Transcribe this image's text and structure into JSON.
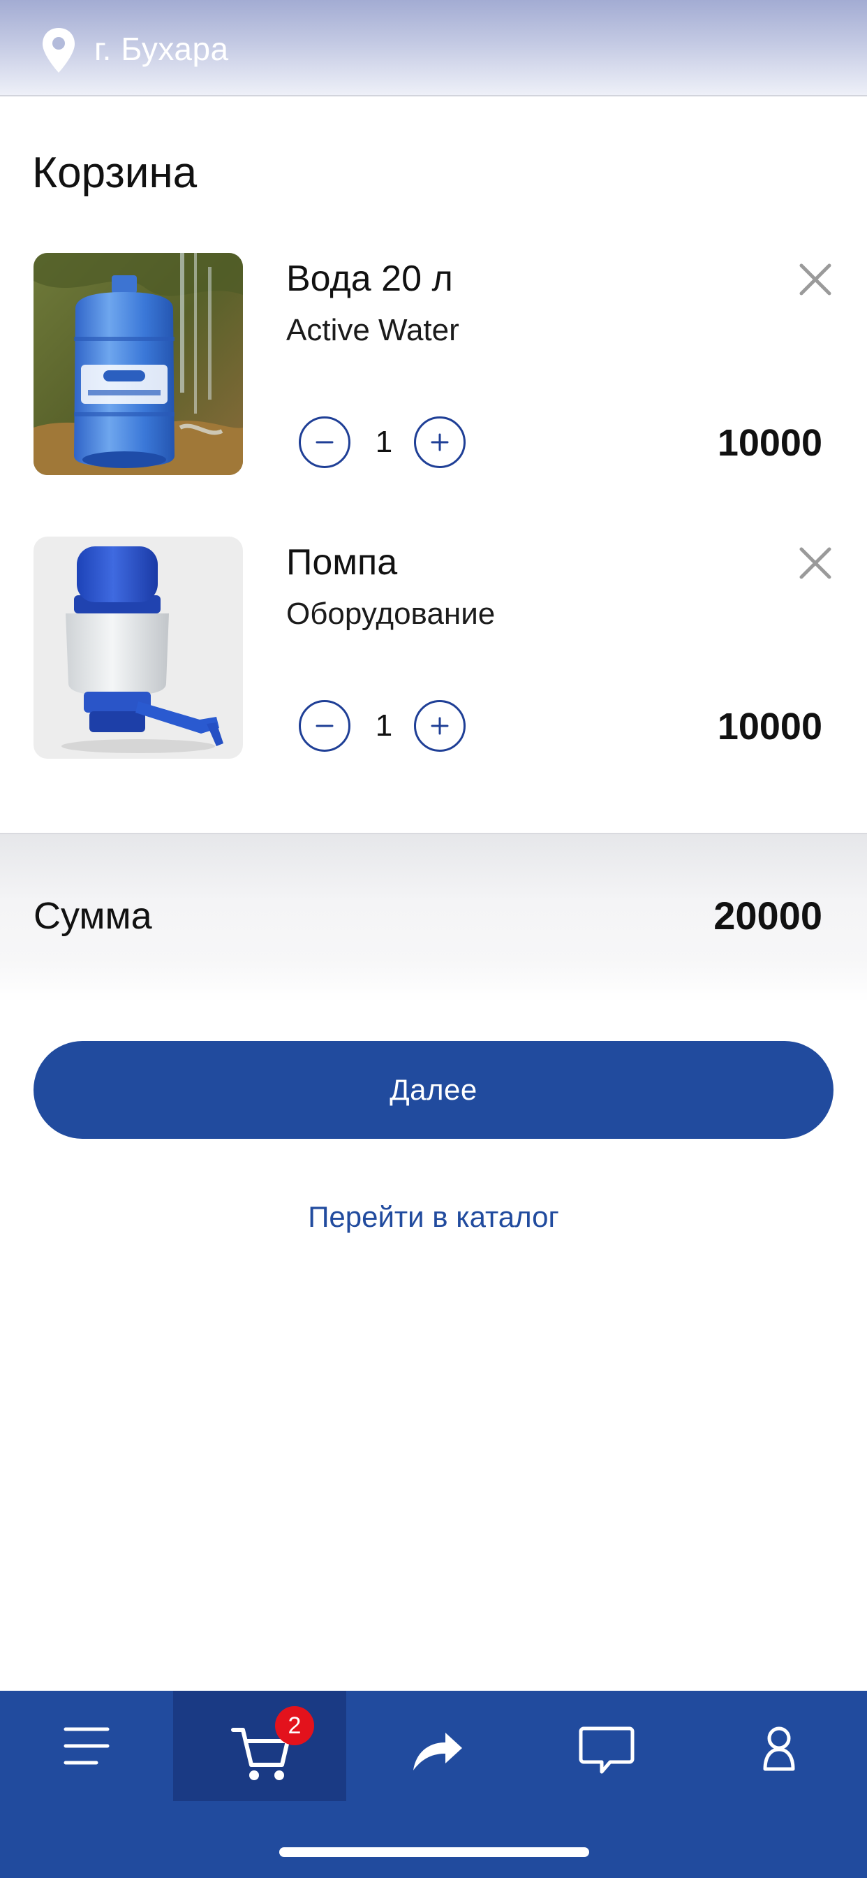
{
  "header": {
    "city": "г. Бухара"
  },
  "page": {
    "title": "Корзина"
  },
  "cart": {
    "items": [
      {
        "name": "Вода 20 л",
        "subtitle": "Active Water",
        "quantity": "1",
        "price": "10000"
      },
      {
        "name": "Помпа",
        "subtitle": "Оборудование",
        "quantity": "1",
        "price": "10000"
      }
    ]
  },
  "summary": {
    "label": "Сумма",
    "total": "20000"
  },
  "actions": {
    "next_label": "Далее",
    "catalog_link": "Перейти в каталог"
  },
  "bottom_nav": {
    "cart_badge": "2",
    "items": [
      "menu-icon",
      "cart-icon",
      "share-icon",
      "chat-icon",
      "profile-icon"
    ]
  },
  "colors": {
    "brand_blue": "#214b9e",
    "active_tab": "#1a3a84",
    "badge_red": "#e3121c",
    "close_gray": "#9a9a9a"
  }
}
